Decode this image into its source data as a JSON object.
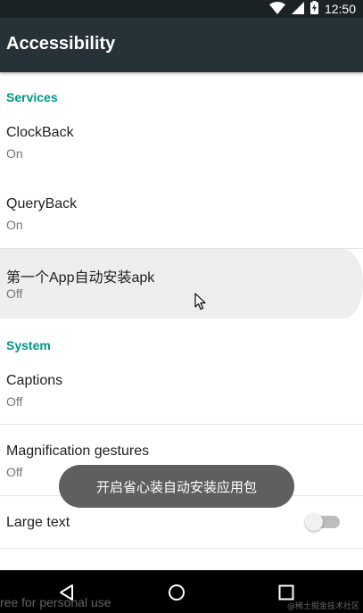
{
  "status_bar": {
    "time": "12:50",
    "icons": [
      "wifi-icon",
      "signal-icon",
      "battery-icon"
    ]
  },
  "app_bar": {
    "title": "Accessibility"
  },
  "sections": {
    "services": {
      "header": "Services",
      "items": [
        {
          "title": "ClockBack",
          "summary": "On"
        },
        {
          "title": "QueryBack",
          "summary": "On"
        },
        {
          "title": "第一个App自动安装apk",
          "summary": "Off"
        }
      ]
    },
    "system": {
      "header": "System",
      "items": [
        {
          "title": "Captions",
          "summary": "Off"
        },
        {
          "title": "Magnification gestures",
          "summary": "Off"
        },
        {
          "title": "Large text",
          "switch_on": false
        }
      ]
    }
  },
  "toast": {
    "text": "开启省心装自动安装应用包"
  },
  "nav_bar": {
    "buttons": [
      "back-icon",
      "home-icon",
      "recents-icon"
    ]
  },
  "watermarks": {
    "left": "ree for personal use",
    "right": "@稀土掘金技术社区"
  },
  "colors": {
    "status_bar": "#1b2327",
    "app_bar": "#263238",
    "accent": "#009688",
    "toast": "#5f5f5f",
    "highlight_row": "#eeeeee"
  }
}
